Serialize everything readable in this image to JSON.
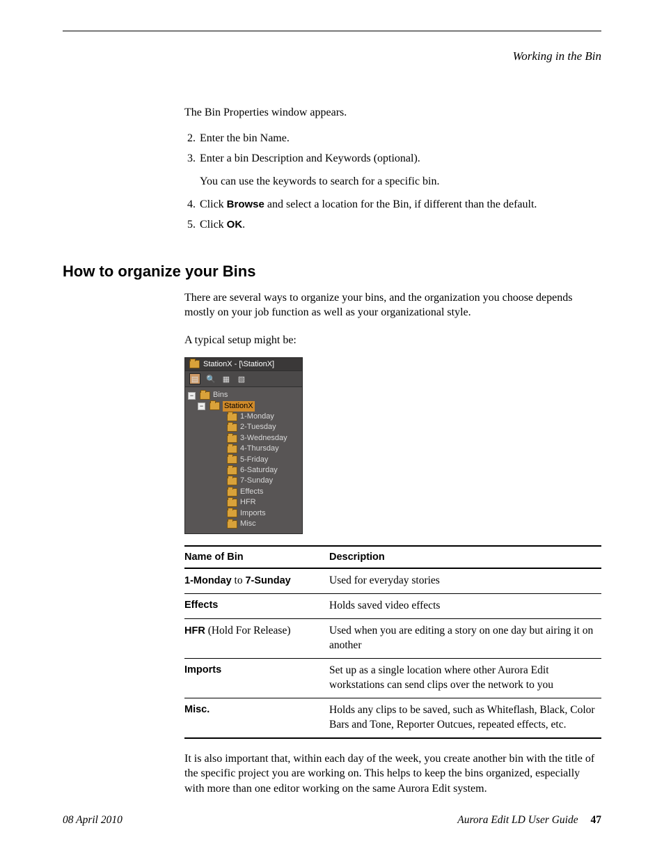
{
  "header": {
    "running_head": "Working in the Bin"
  },
  "intro_para": "The Bin Properties window appears.",
  "steps": [
    {
      "n": 2,
      "text": "Enter the bin Name."
    },
    {
      "n": 3,
      "text": "Enter a bin Description and Keywords (optional).",
      "sub": "You can use the keywords to search for a specific bin."
    },
    {
      "n": 4,
      "pre": "Click ",
      "bold": "Browse",
      "post": " and select a location for the Bin, if different than the default."
    },
    {
      "n": 5,
      "pre": "Click ",
      "bold": "OK",
      "post": "."
    }
  ],
  "section_heading": "How to organize your Bins",
  "section_para1": "There are several ways to organize your bins, and the organization you choose depends mostly on your job function as well as your organizational style.",
  "section_para2": "A typical setup might be:",
  "tree": {
    "title": "StationX - [\\StationX]",
    "root": "Bins",
    "station": "StationX",
    "items": [
      "1-Monday",
      "2-Tuesday",
      "3-Wednesday",
      "4-Thursday",
      "5-Friday",
      "6-Saturday",
      "7-Sunday",
      "Effects",
      "HFR",
      "Imports",
      "Misc"
    ]
  },
  "table": {
    "headers": [
      "Name of Bin",
      "Description"
    ],
    "rows": [
      {
        "name_bold1": "1-Monday",
        "name_mid": " to ",
        "name_bold2": "7-Sunday",
        "desc": "Used for everyday stories"
      },
      {
        "name_bold1": "Effects",
        "desc": "Holds saved video effects"
      },
      {
        "name_bold1": "HFR",
        "name_paren": " (Hold For Release)",
        "desc": "Used when you are editing a story on one day but airing it on another"
      },
      {
        "name_bold1": "Imports",
        "desc": "Set up as a single location where other Aurora Edit workstations can send clips over the network to you"
      },
      {
        "name_bold1": "Misc.",
        "desc": "Holds any clips to be saved, such as Whiteflash, Black, Color Bars and Tone, Reporter Outcues, repeated effects, etc."
      }
    ]
  },
  "closing_para": "It is also important that, within each day of the week, you create another bin with the title of the specific project you are working on. This helps to keep the bins organized, especially with more than one editor working on the same Aurora Edit system.",
  "footer": {
    "date": "08 April 2010",
    "book": "Aurora Edit LD User Guide",
    "page": "47"
  }
}
